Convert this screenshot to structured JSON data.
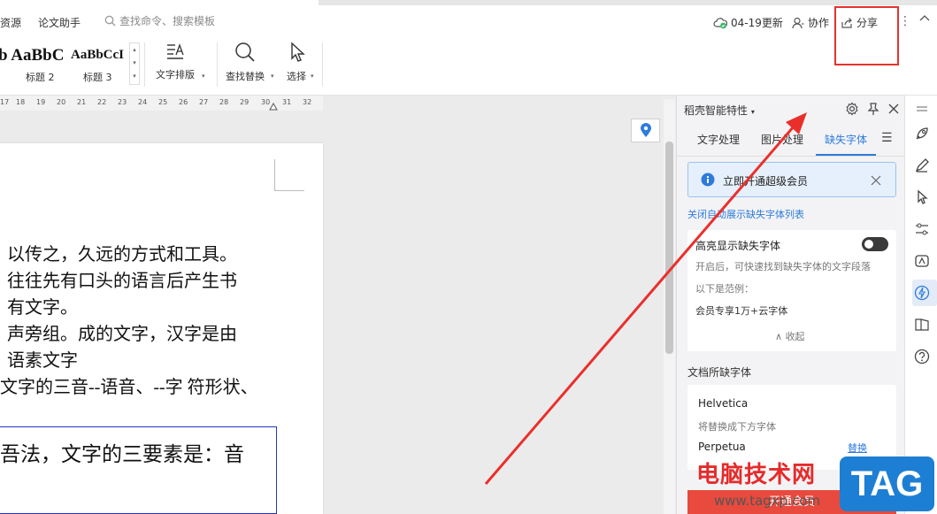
{
  "menubar": {
    "item_resource": "资源",
    "item_thesis": "论文助手",
    "search_placeholder": "查找命令、搜索模板",
    "update_label": "04-19更新",
    "collab_label": "协作",
    "share_label": "分享"
  },
  "ribbon": {
    "styles": [
      {
        "preview": "b AaBbC",
        "caption": "标题 2"
      },
      {
        "preview": "AaBbCcI",
        "caption": "标题 3"
      }
    ],
    "text_layout_label": "文字排版",
    "find_replace_label": "查找替换",
    "select_label": "选择"
  },
  "ruler": {
    "ticks": [
      "17",
      "18",
      "19",
      "20",
      "21",
      "22",
      "23",
      "24",
      "25",
      "26",
      "27",
      "28",
      "29",
      "30",
      "31",
      "32"
    ]
  },
  "document": {
    "lines": [
      "以传之，久远的方式和工具。",
      "往往先有口头的语言后产生书",
      "有文字。",
      "声旁组。成的文字，汉字是由",
      "语素文字",
      "文字的三音--语音、--字  符形状、"
    ],
    "textbox_line": "吾法，文字的三要素是：音"
  },
  "panel": {
    "title": "稻壳智能特性",
    "tabs": [
      "文字处理",
      "图片处理",
      "缺失字体"
    ],
    "active_tab_index": 2,
    "banner_text": "立即开通超级会员",
    "close_list_link": "关闭自动展示缺失字体列表",
    "highlight_label": "高亮显示缺失字体",
    "highlight_on": false,
    "highlight_desc": "开启后，可快速找到缺失字体的文字段落",
    "example_label": "以下是范例：",
    "example_value": "会员专享1万+云字体",
    "collapse_label": "收起",
    "missing_section_title": "文档所缺字体",
    "missing_fonts": [
      {
        "name": "Helvetica",
        "note": "将替换成下方字体"
      },
      {
        "name": "Perpetua",
        "action": "替换"
      }
    ],
    "bottom_button_label": "开通会员"
  },
  "watermark": {
    "cn_text": "电脑技术网",
    "url": "www.tagxp.com",
    "tag": "TAG"
  },
  "colors": {
    "accent": "#2e7bdc",
    "annotation_red": "#e8322c",
    "button_red": "#e84a3d"
  }
}
